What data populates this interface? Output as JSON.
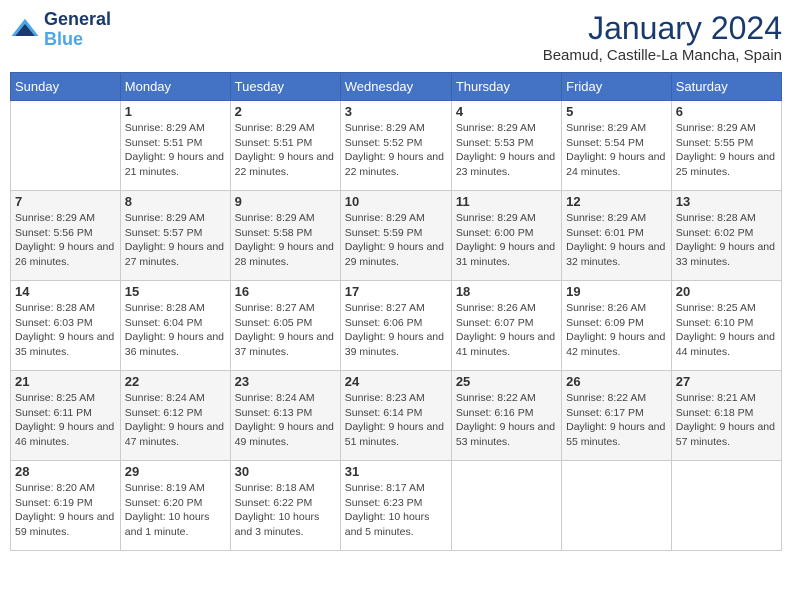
{
  "header": {
    "logo_line1": "General",
    "logo_line2": "Blue",
    "month": "January 2024",
    "location": "Beamud, Castille-La Mancha, Spain"
  },
  "weekdays": [
    "Sunday",
    "Monday",
    "Tuesday",
    "Wednesday",
    "Thursday",
    "Friday",
    "Saturday"
  ],
  "weeks": [
    [
      {
        "day": "",
        "sunrise": "",
        "sunset": "",
        "daylight": ""
      },
      {
        "day": "1",
        "sunrise": "Sunrise: 8:29 AM",
        "sunset": "Sunset: 5:51 PM",
        "daylight": "Daylight: 9 hours and 21 minutes."
      },
      {
        "day": "2",
        "sunrise": "Sunrise: 8:29 AM",
        "sunset": "Sunset: 5:51 PM",
        "daylight": "Daylight: 9 hours and 22 minutes."
      },
      {
        "day": "3",
        "sunrise": "Sunrise: 8:29 AM",
        "sunset": "Sunset: 5:52 PM",
        "daylight": "Daylight: 9 hours and 22 minutes."
      },
      {
        "day": "4",
        "sunrise": "Sunrise: 8:29 AM",
        "sunset": "Sunset: 5:53 PM",
        "daylight": "Daylight: 9 hours and 23 minutes."
      },
      {
        "day": "5",
        "sunrise": "Sunrise: 8:29 AM",
        "sunset": "Sunset: 5:54 PM",
        "daylight": "Daylight: 9 hours and 24 minutes."
      },
      {
        "day": "6",
        "sunrise": "Sunrise: 8:29 AM",
        "sunset": "Sunset: 5:55 PM",
        "daylight": "Daylight: 9 hours and 25 minutes."
      }
    ],
    [
      {
        "day": "7",
        "sunrise": "Sunrise: 8:29 AM",
        "sunset": "Sunset: 5:56 PM",
        "daylight": "Daylight: 9 hours and 26 minutes."
      },
      {
        "day": "8",
        "sunrise": "Sunrise: 8:29 AM",
        "sunset": "Sunset: 5:57 PM",
        "daylight": "Daylight: 9 hours and 27 minutes."
      },
      {
        "day": "9",
        "sunrise": "Sunrise: 8:29 AM",
        "sunset": "Sunset: 5:58 PM",
        "daylight": "Daylight: 9 hours and 28 minutes."
      },
      {
        "day": "10",
        "sunrise": "Sunrise: 8:29 AM",
        "sunset": "Sunset: 5:59 PM",
        "daylight": "Daylight: 9 hours and 29 minutes."
      },
      {
        "day": "11",
        "sunrise": "Sunrise: 8:29 AM",
        "sunset": "Sunset: 6:00 PM",
        "daylight": "Daylight: 9 hours and 31 minutes."
      },
      {
        "day": "12",
        "sunrise": "Sunrise: 8:29 AM",
        "sunset": "Sunset: 6:01 PM",
        "daylight": "Daylight: 9 hours and 32 minutes."
      },
      {
        "day": "13",
        "sunrise": "Sunrise: 8:28 AM",
        "sunset": "Sunset: 6:02 PM",
        "daylight": "Daylight: 9 hours and 33 minutes."
      }
    ],
    [
      {
        "day": "14",
        "sunrise": "Sunrise: 8:28 AM",
        "sunset": "Sunset: 6:03 PM",
        "daylight": "Daylight: 9 hours and 35 minutes."
      },
      {
        "day": "15",
        "sunrise": "Sunrise: 8:28 AM",
        "sunset": "Sunset: 6:04 PM",
        "daylight": "Daylight: 9 hours and 36 minutes."
      },
      {
        "day": "16",
        "sunrise": "Sunrise: 8:27 AM",
        "sunset": "Sunset: 6:05 PM",
        "daylight": "Daylight: 9 hours and 37 minutes."
      },
      {
        "day": "17",
        "sunrise": "Sunrise: 8:27 AM",
        "sunset": "Sunset: 6:06 PM",
        "daylight": "Daylight: 9 hours and 39 minutes."
      },
      {
        "day": "18",
        "sunrise": "Sunrise: 8:26 AM",
        "sunset": "Sunset: 6:07 PM",
        "daylight": "Daylight: 9 hours and 41 minutes."
      },
      {
        "day": "19",
        "sunrise": "Sunrise: 8:26 AM",
        "sunset": "Sunset: 6:09 PM",
        "daylight": "Daylight: 9 hours and 42 minutes."
      },
      {
        "day": "20",
        "sunrise": "Sunrise: 8:25 AM",
        "sunset": "Sunset: 6:10 PM",
        "daylight": "Daylight: 9 hours and 44 minutes."
      }
    ],
    [
      {
        "day": "21",
        "sunrise": "Sunrise: 8:25 AM",
        "sunset": "Sunset: 6:11 PM",
        "daylight": "Daylight: 9 hours and 46 minutes."
      },
      {
        "day": "22",
        "sunrise": "Sunrise: 8:24 AM",
        "sunset": "Sunset: 6:12 PM",
        "daylight": "Daylight: 9 hours and 47 minutes."
      },
      {
        "day": "23",
        "sunrise": "Sunrise: 8:24 AM",
        "sunset": "Sunset: 6:13 PM",
        "daylight": "Daylight: 9 hours and 49 minutes."
      },
      {
        "day": "24",
        "sunrise": "Sunrise: 8:23 AM",
        "sunset": "Sunset: 6:14 PM",
        "daylight": "Daylight: 9 hours and 51 minutes."
      },
      {
        "day": "25",
        "sunrise": "Sunrise: 8:22 AM",
        "sunset": "Sunset: 6:16 PM",
        "daylight": "Daylight: 9 hours and 53 minutes."
      },
      {
        "day": "26",
        "sunrise": "Sunrise: 8:22 AM",
        "sunset": "Sunset: 6:17 PM",
        "daylight": "Daylight: 9 hours and 55 minutes."
      },
      {
        "day": "27",
        "sunrise": "Sunrise: 8:21 AM",
        "sunset": "Sunset: 6:18 PM",
        "daylight": "Daylight: 9 hours and 57 minutes."
      }
    ],
    [
      {
        "day": "28",
        "sunrise": "Sunrise: 8:20 AM",
        "sunset": "Sunset: 6:19 PM",
        "daylight": "Daylight: 9 hours and 59 minutes."
      },
      {
        "day": "29",
        "sunrise": "Sunrise: 8:19 AM",
        "sunset": "Sunset: 6:20 PM",
        "daylight": "Daylight: 10 hours and 1 minute."
      },
      {
        "day": "30",
        "sunrise": "Sunrise: 8:18 AM",
        "sunset": "Sunset: 6:22 PM",
        "daylight": "Daylight: 10 hours and 3 minutes."
      },
      {
        "day": "31",
        "sunrise": "Sunrise: 8:17 AM",
        "sunset": "Sunset: 6:23 PM",
        "daylight": "Daylight: 10 hours and 5 minutes."
      },
      {
        "day": "",
        "sunrise": "",
        "sunset": "",
        "daylight": ""
      },
      {
        "day": "",
        "sunrise": "",
        "sunset": "",
        "daylight": ""
      },
      {
        "day": "",
        "sunrise": "",
        "sunset": "",
        "daylight": ""
      }
    ]
  ]
}
